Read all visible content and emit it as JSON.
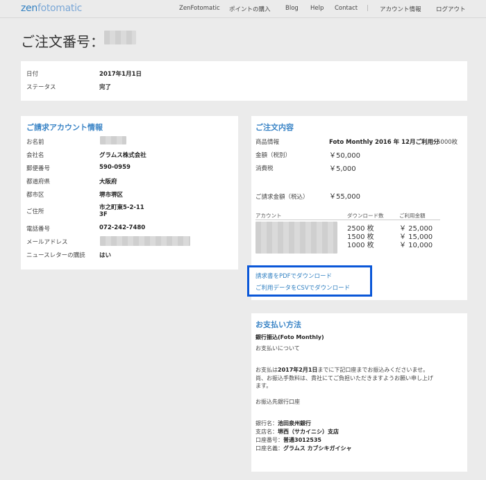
{
  "header": {
    "logo_prefix": "zen",
    "logo_suffix": "fotomatic",
    "nav": [
      "ZenFotomatic",
      "ポイントの購入",
      "Blog",
      "Help",
      "Contact",
      "|",
      "アカウント情報",
      "ログアウト"
    ]
  },
  "page_title": "ご注文番号：",
  "summary": {
    "date_label": "日付",
    "date_value": "2017年1月1日",
    "status_label": "ステータス",
    "status_value": "完了"
  },
  "billing": {
    "title": "ご請求アカウント情報",
    "rows": [
      {
        "label": "お名前",
        "value": ""
      },
      {
        "label": "会社名",
        "value": "グラムス株式会社"
      },
      {
        "label": "郵便番号",
        "value": "590-0959"
      },
      {
        "label": "都道府県",
        "value": "大阪府"
      },
      {
        "label": "都市区",
        "value": "堺市堺区"
      },
      {
        "label": "ご住所",
        "value": "市之町東5-2-11",
        "value2": "3F"
      },
      {
        "label": "電話番号",
        "value": "072-242-7480"
      },
      {
        "label": "メールアドレス",
        "value": ""
      },
      {
        "label": "ニュースレターの購読",
        "value": "はい"
      }
    ]
  },
  "order": {
    "title": "ご注文内容",
    "product_label": "商品情報",
    "product_value": "Foto Monthly 2016 年 12月ご利用分",
    "product_count": "5000枚",
    "amount_label": "金額（税別）",
    "amount_value": "￥50,000",
    "tax_label": "消費税",
    "tax_value": "￥5,000",
    "total_label": "ご請求金額（税込）",
    "total_value": "￥55,000",
    "table": {
      "headers": [
        "アカウント",
        "ダウンロード数",
        "ご利用金額"
      ],
      "rows": [
        {
          "count": "2500 枚",
          "amount": "￥ 25,000"
        },
        {
          "count": "1500 枚",
          "amount": "￥ 15,000"
        },
        {
          "count": "1000 枚",
          "amount": "￥ 10,000"
        }
      ]
    },
    "download_pdf": "請求書をPDFでダウンロード",
    "download_csv": "ご利用データをCSVでダウンロード"
  },
  "payment": {
    "title": "お支払い方法",
    "method": "銀行振込(Foto Monthly)",
    "about": "お支払いについて",
    "line1_pre": "お支払は",
    "line1_date": "2017年2月1日",
    "line1_post": "までに下記口座までお振込みくださいませ。",
    "line2": "尚、お振込手数料は、貴社にてご負担いただきますようお願い申し上げ",
    "line3": "ます。",
    "bank_heading": "お振込先銀行口座",
    "bank_label": "銀行名：",
    "bank_value": "池田泉州銀行",
    "branch_label": "支店名：",
    "branch_value": "堺西（サカイニシ）支店",
    "account_label": "口座番号：",
    "account_value": "普通3012535",
    "holder_label": "口座名義：",
    "holder_value": "グラムス カブシキガイシャ"
  }
}
